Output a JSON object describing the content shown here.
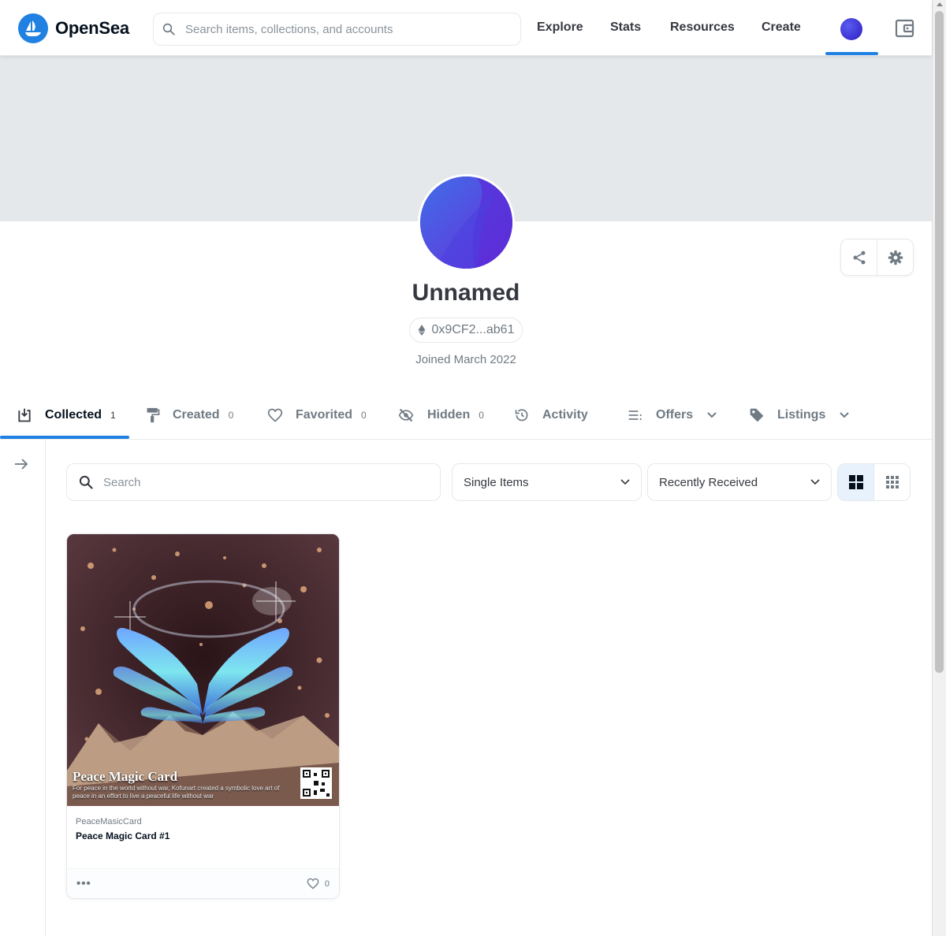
{
  "header": {
    "logo_text": "OpenSea",
    "search_placeholder": "Search items, collections, and accounts",
    "nav": [
      {
        "label": "Explore"
      },
      {
        "label": "Stats"
      },
      {
        "label": "Resources"
      },
      {
        "label": "Create"
      }
    ]
  },
  "profile": {
    "name": "Unnamed",
    "address": "0x9CF2...ab61",
    "joined": "Joined March 2022"
  },
  "tabs": [
    {
      "label": "Collected",
      "count": "1",
      "active": true,
      "icon": "collected-icon"
    },
    {
      "label": "Created",
      "count": "0",
      "icon": "paint-roller-icon"
    },
    {
      "label": "Favorited",
      "count": "0",
      "icon": "heart-icon"
    },
    {
      "label": "Hidden",
      "count": "0",
      "icon": "eye-off-icon"
    },
    {
      "label": "Activity",
      "count": "",
      "icon": "history-icon"
    },
    {
      "label": "Offers",
      "count": "",
      "icon": "list-icon"
    },
    {
      "label": "Listings",
      "count": "",
      "icon": "tag-icon"
    }
  ],
  "filters": {
    "search_placeholder": "Search",
    "item_type": "Single Items",
    "sort": "Recently Received"
  },
  "items": [
    {
      "collection": "PeaceMasicCard",
      "name": "Peace Magic Card #1",
      "art_title": "Peace Magic Card",
      "art_subtitle": "For peace in the world without war, Kofunart created a symbolic love art of peace in an effort to live a peaceful life without war",
      "likes": "0"
    }
  ],
  "colors": {
    "brand": "#2081e2",
    "banner": "#e5e8eb",
    "avatar": "#5b3de6",
    "text": "#04111d",
    "muted": "#707a83"
  }
}
